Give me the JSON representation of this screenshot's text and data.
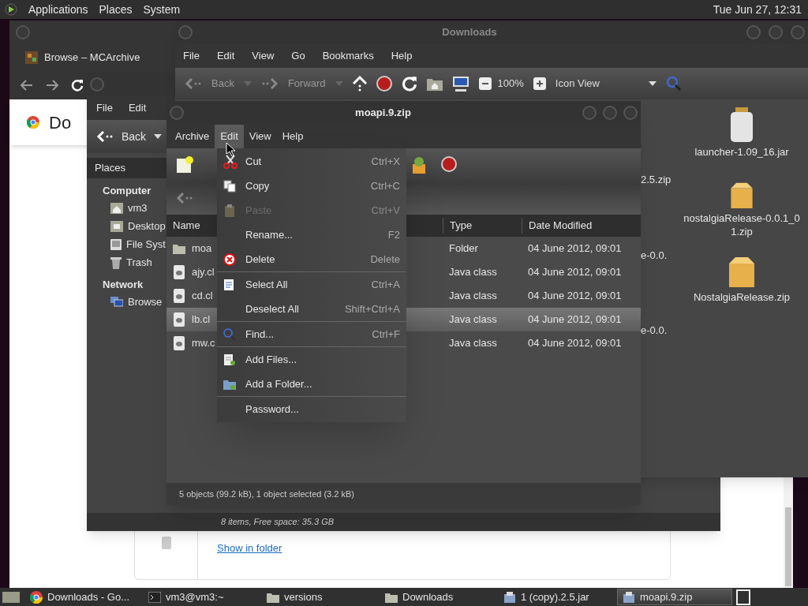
{
  "top_panel": {
    "menus": [
      "Applications",
      "Places",
      "System"
    ],
    "clock": "Tue Jun 27, 12:31"
  },
  "browser": {
    "tab": "Browse – MCArchive",
    "heading": "Do",
    "link": "Show in folder"
  },
  "downloads_window": {
    "title": "Downloads",
    "menu": [
      "File",
      "Edit",
      "View",
      "Go",
      "Bookmarks",
      "Help"
    ],
    "toolbar": {
      "back": "Back",
      "forward": "Forward",
      "zoom": "100%",
      "view": "Icon View"
    },
    "partial_labels": [
      "2.5.zip",
      "e-0.0.",
      "e-0.0."
    ],
    "icons": [
      {
        "label": "launcher-1.09_16.jar",
        "kind": "jar"
      },
      {
        "label": "nostalgiaRelease-0.0.1_01.zip",
        "kind": "archive"
      },
      {
        "label": "NostalgiaRelease.zip",
        "kind": "archive"
      }
    ]
  },
  "file_manager": {
    "menu": [
      "File",
      "Edit"
    ],
    "back": "Back",
    "places_header": "Places",
    "sections": [
      {
        "title": "Computer",
        "items": [
          {
            "label": "vm3",
            "kind": "home"
          },
          {
            "label": "Desktop",
            "kind": "desktop"
          },
          {
            "label": "File Syst",
            "kind": "drive"
          },
          {
            "label": "Trash",
            "kind": "trash"
          }
        ]
      },
      {
        "title": "Network",
        "items": [
          {
            "label": "Browse",
            "kind": "network"
          }
        ]
      }
    ],
    "status": "8 items, Free space: 35.3 GB"
  },
  "archive_window": {
    "title": "moapi.9.zip",
    "menu": [
      {
        "label": "Archive",
        "selected": false
      },
      {
        "label": "Edit",
        "selected": true
      },
      {
        "label": "View",
        "selected": false
      },
      {
        "label": "Help",
        "selected": false
      }
    ],
    "columns": [
      "Name",
      "Type",
      "Date Modified"
    ],
    "rows": [
      {
        "name": "moa",
        "kind": "folder",
        "type": "Folder",
        "date": "04 June 2012, 09:01",
        "selected": false
      },
      {
        "name": "ajy.cl",
        "kind": "class",
        "type": "Java class",
        "date": "04 June 2012, 09:01",
        "selected": false
      },
      {
        "name": "cd.cl",
        "kind": "class",
        "type": "Java class",
        "date": "04 June 2012, 09:01",
        "selected": false
      },
      {
        "name": "lb.cl",
        "kind": "class",
        "type": "Java class",
        "date": "04 June 2012, 09:01",
        "selected": true
      },
      {
        "name": "mw.c",
        "kind": "class",
        "type": "Java class",
        "date": "04 June 2012, 09:01",
        "selected": false
      }
    ],
    "status": "5 objects (99.2 kB), 1 object selected (3.2 kB)"
  },
  "edit_menu": {
    "groups": [
      {
        "items": [
          {
            "label": "Cut",
            "shortcut": "Ctrl+X",
            "kind": "cut",
            "disabled": false
          },
          {
            "label": "Copy",
            "shortcut": "Ctrl+C",
            "kind": "copy",
            "disabled": false
          },
          {
            "label": "Paste",
            "shortcut": "Ctrl+V",
            "kind": "paste",
            "disabled": true
          },
          {
            "label": "Rename...",
            "shortcut": "F2",
            "kind": "plain",
            "disabled": false
          },
          {
            "label": "Delete",
            "shortcut": "Delete",
            "kind": "delete",
            "disabled": false
          }
        ]
      },
      {
        "items": [
          {
            "label": "Select All",
            "shortcut": "Ctrl+A",
            "kind": "select",
            "disabled": false
          },
          {
            "label": "Deselect All",
            "shortcut": "Shift+Ctrl+A",
            "kind": "plain",
            "disabled": false
          }
        ]
      },
      {
        "items": [
          {
            "label": "Find...",
            "shortcut": "Ctrl+F",
            "kind": "find",
            "disabled": false
          }
        ]
      },
      {
        "items": [
          {
            "label": "Add Files...",
            "kind": "addfile",
            "disabled": false
          },
          {
            "label": "Add a Folder...",
            "kind": "addfolder",
            "disabled": false
          }
        ]
      },
      {
        "items": [
          {
            "label": "Password...",
            "kind": "plain",
            "disabled": false
          }
        ]
      }
    ]
  },
  "taskbar": [
    {
      "label": "Downloads - Go...",
      "kind": "browser",
      "selected": false
    },
    {
      "label": "vm3@vm3:~",
      "kind": "terminal",
      "selected": false
    },
    {
      "label": "versions",
      "kind": "folder",
      "selected": false
    },
    {
      "label": "Downloads",
      "kind": "folder",
      "selected": false
    },
    {
      "label": "1 (copy).2.5.jar",
      "kind": "archive",
      "selected": false
    },
    {
      "label": "moapi.9.zip",
      "kind": "archive",
      "selected": true
    }
  ]
}
